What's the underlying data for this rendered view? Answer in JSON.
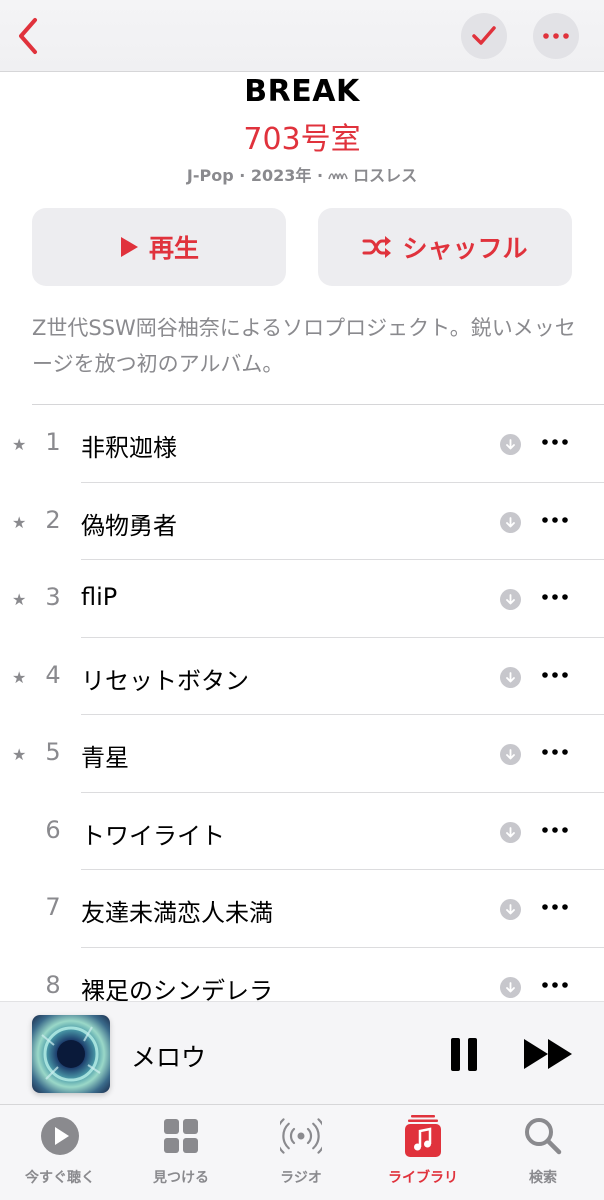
{
  "album": {
    "title": "BREAK",
    "artist": "703号室",
    "meta_genre_year": "J-Pop · 2023年 ·",
    "meta_lossless": "ロスレス",
    "description": "Z世代SSW岡谷柚奈によるソロプロジェクト。鋭いメッセージを放つ初のアルバム。"
  },
  "actions": {
    "play_label": "再生",
    "shuffle_label": "シャッフル"
  },
  "tracks": [
    {
      "num": "1",
      "title": "非釈迦様",
      "starred": true
    },
    {
      "num": "2",
      "title": "偽物勇者",
      "starred": true
    },
    {
      "num": "3",
      "title": "fliP",
      "starred": true
    },
    {
      "num": "4",
      "title": "リセットボタン",
      "starred": true
    },
    {
      "num": "5",
      "title": "青星",
      "starred": true
    },
    {
      "num": "6",
      "title": "トワイライト",
      "starred": false
    },
    {
      "num": "7",
      "title": "友達未満恋人未満",
      "starred": false
    },
    {
      "num": "8",
      "title": "裸足のシンデレラ",
      "starred": false
    }
  ],
  "now_playing": {
    "title": "メロウ"
  },
  "tabs": [
    {
      "label": "今すぐ聴く",
      "icon": "play-circle-icon",
      "active": false
    },
    {
      "label": "見つける",
      "icon": "grid-icon",
      "active": false
    },
    {
      "label": "ラジオ",
      "icon": "radio-icon",
      "active": false
    },
    {
      "label": "ライブラリ",
      "icon": "library-music-icon",
      "active": true
    },
    {
      "label": "検索",
      "icon": "search-icon",
      "active": false
    }
  ],
  "colors": {
    "accent": "#e0323c",
    "secondary_text": "#8a8a8e"
  }
}
